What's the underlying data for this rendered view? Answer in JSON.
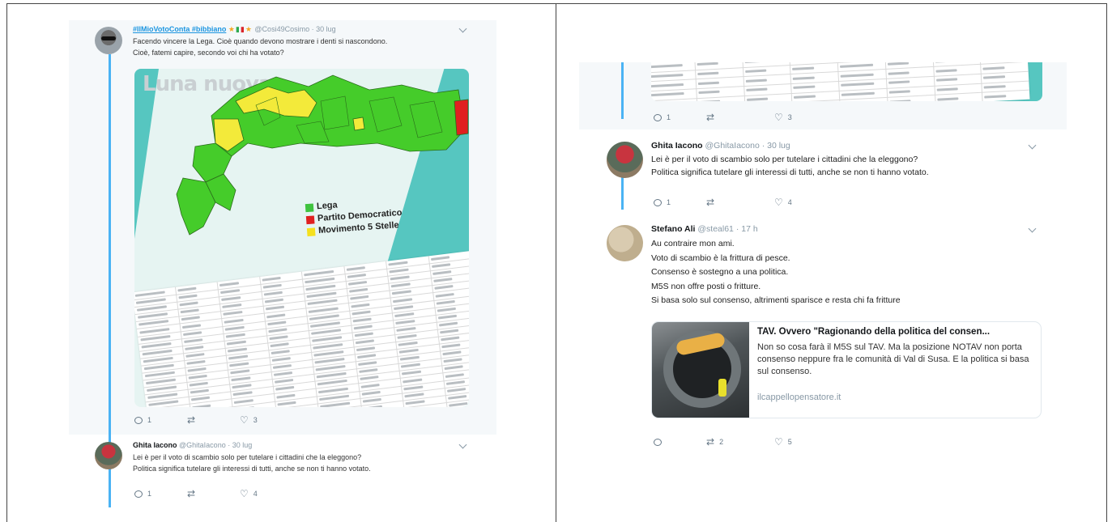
{
  "left": {
    "tweet1": {
      "name": "#IlMioVotoConta #bibbiano",
      "flags": "★▮▮★",
      "handle": "@Cosi49Cosimo",
      "time": "· 30 lug",
      "text_lines": [
        "Facendo vincere la Lega. Cioè quando devono mostrare i denti si nascondono.",
        "Cioè, fatemi capire, secondo voi chi ha votato?"
      ],
      "media": {
        "watermark": "Luna nuova",
        "legend": [
          {
            "label": "Lega",
            "color": "#3fc33f"
          },
          {
            "label": "Partito Democratico",
            "color": "#e02020"
          },
          {
            "label": "Movimento 5 Stelle",
            "color": "#f5e01e"
          }
        ],
        "map_colors": {
          "lega": "#45cc2a",
          "pd": "#e02020",
          "m5s": "#f3ea3a"
        }
      },
      "actions": {
        "replies": "1",
        "retweets": "",
        "likes": "3"
      }
    },
    "tweet2": {
      "name": "Ghita Iacono",
      "handle": "@GhitaIacono",
      "time": "· 30 lug",
      "text_lines": [
        "Lei è per il voto di scambio solo per tutelare i cittadini che la eleggono?",
        "Politica significa tutelare gli interessi di tutti, anche se non ti hanno votato."
      ],
      "actions": {
        "replies": "1",
        "retweets": "",
        "likes": "4"
      }
    }
  },
  "right": {
    "top_actions": {
      "replies": "1",
      "retweets": "",
      "likes": "3"
    },
    "tweet1": {
      "name": "Ghita Iacono",
      "handle": "@GhitaIacono",
      "time": "· 30 lug",
      "text_lines": [
        "Lei è per il voto di scambio solo per tutelare i cittadini che la eleggono?",
        "Politica significa tutelare gli interessi di tutti, anche se non ti hanno votato."
      ],
      "actions": {
        "replies": "1",
        "retweets": "",
        "likes": "4"
      }
    },
    "tweet2": {
      "name": "Stefano Ali",
      "handle": "@steal61",
      "time": "· 17 h",
      "text_lines": [
        "Au contraire mon ami.",
        "Voto di scambio è la frittura di pesce.",
        "Consenso è sostegno a una politica.",
        "M5S non offre posti o fritture.",
        "Si basa solo sul consenso, altrimenti sparisce e resta chi fa fritture"
      ],
      "card": {
        "title": "TAV. Ovvero \"Ragionando della politica del consen...",
        "description": "Non so cosa farà il M5S sul TAV. Ma la posizione NOTAV non porta consenso neppure fra le comunità di Val di Susa. E la politica si basa sul consenso.",
        "url": "ilcappellopensatore.it"
      },
      "actions": {
        "replies": "",
        "retweets": "2",
        "likes": "5"
      }
    }
  },
  "colors": {
    "accent": "#1b95e0",
    "thread": "#4ab3f4",
    "muted": "#657786"
  }
}
